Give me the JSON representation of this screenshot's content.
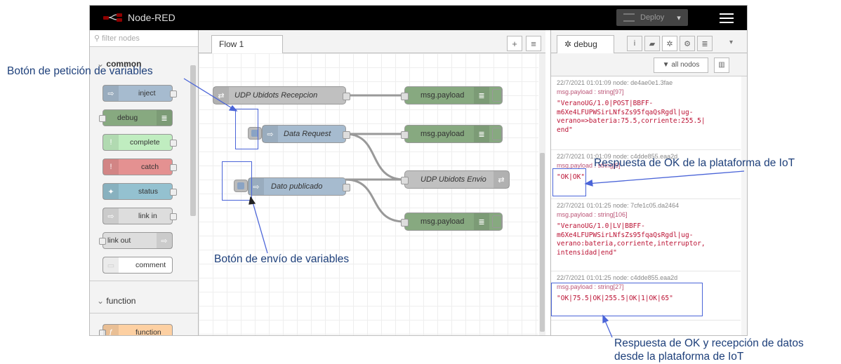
{
  "app": {
    "title": "Node-RED",
    "deploy_label": "Deploy",
    "deploy_caret": "▾",
    "menu_icon": "hamburger-icon"
  },
  "palette": {
    "filter_placeholder": "filter nodes",
    "categories": [
      {
        "label": "common",
        "nodes": [
          {
            "label": "inject",
            "color": "#a6bbcf"
          },
          {
            "label": "debug",
            "color": "#87a980"
          },
          {
            "label": "complete",
            "color": "#c0edc0"
          },
          {
            "label": "catch",
            "color": "#e49191"
          },
          {
            "label": "status",
            "color": "#94c1d0"
          },
          {
            "label": "link in",
            "color": "#dddddd"
          },
          {
            "label": "link out",
            "color": "#dddddd"
          },
          {
            "label": "comment",
            "color": "#ffffff"
          }
        ]
      },
      {
        "label": "function",
        "nodes": [
          {
            "label": "function",
            "color": "#fdd0a2"
          }
        ]
      }
    ]
  },
  "workspace": {
    "tab": "Flow 1",
    "add_icon": "+",
    "list_icon": "≡",
    "nodes": {
      "udp_in": "UDP Ubidots Recepcion",
      "data_request": "Data Request",
      "dato_publicado": "Dato publicado",
      "udp_out": "UDP Ubidots Envio",
      "debug_1": "msg.payload",
      "debug_2": "msg.payload",
      "debug_3": "msg.payload"
    }
  },
  "sidebar": {
    "tab": "debug",
    "filter_label": "all nodos",
    "messages": [
      {
        "meta": "22/7/2021 01:01:09   node: de4ae0e1.3fae",
        "type": "msg.payload : string[97]",
        "value": "\"VeranoUG/1.0|POST|BBFF-\nm6Xe4LFUPWSirLNfsZs95fqaQsRgdl|ug-\nverano=>bateria:75.5,corriente:255.5|\nend\""
      },
      {
        "meta": "22/7/2021 01:01:09   node: c4dde855.eaa2d",
        "type": "msg.payload : string[5]",
        "value": "\"OK|OK\""
      },
      {
        "meta": "22/7/2021 01:01:25   node: 7cfe1c05.da2464",
        "type": "msg.payload : string[106]",
        "value": "\"VeranoUG/1.0|LV|BBFF-\nm6Xe4LFUPWSirLNfsZs95fqaQsRgdl|ug-\nverano:bateria,corriente,interruptor,\nintensidad|end\""
      },
      {
        "meta": "22/7/2021 01:01:25   node: c4dde855.eaa2d",
        "type": "msg.payload : string[27]",
        "value": "\"OK|75.5|OK|255.5|OK|1|OK|65\""
      }
    ]
  },
  "annotations": {
    "peticion": "Botón de petición de variables",
    "envio": "Botón de envío de variables",
    "respuesta_ok": "Respuesta de OK de la plataforma de IoT",
    "respuesta_datos_1": "Respuesta de OK  y recepción de datos",
    "respuesta_datos_2": "desde la plataforma de IoT"
  },
  "colors": {
    "inject": "#a6bbcf",
    "debug": "#87a980",
    "udp": "#c0c0c0",
    "annotation_line": "#4a64d8"
  }
}
